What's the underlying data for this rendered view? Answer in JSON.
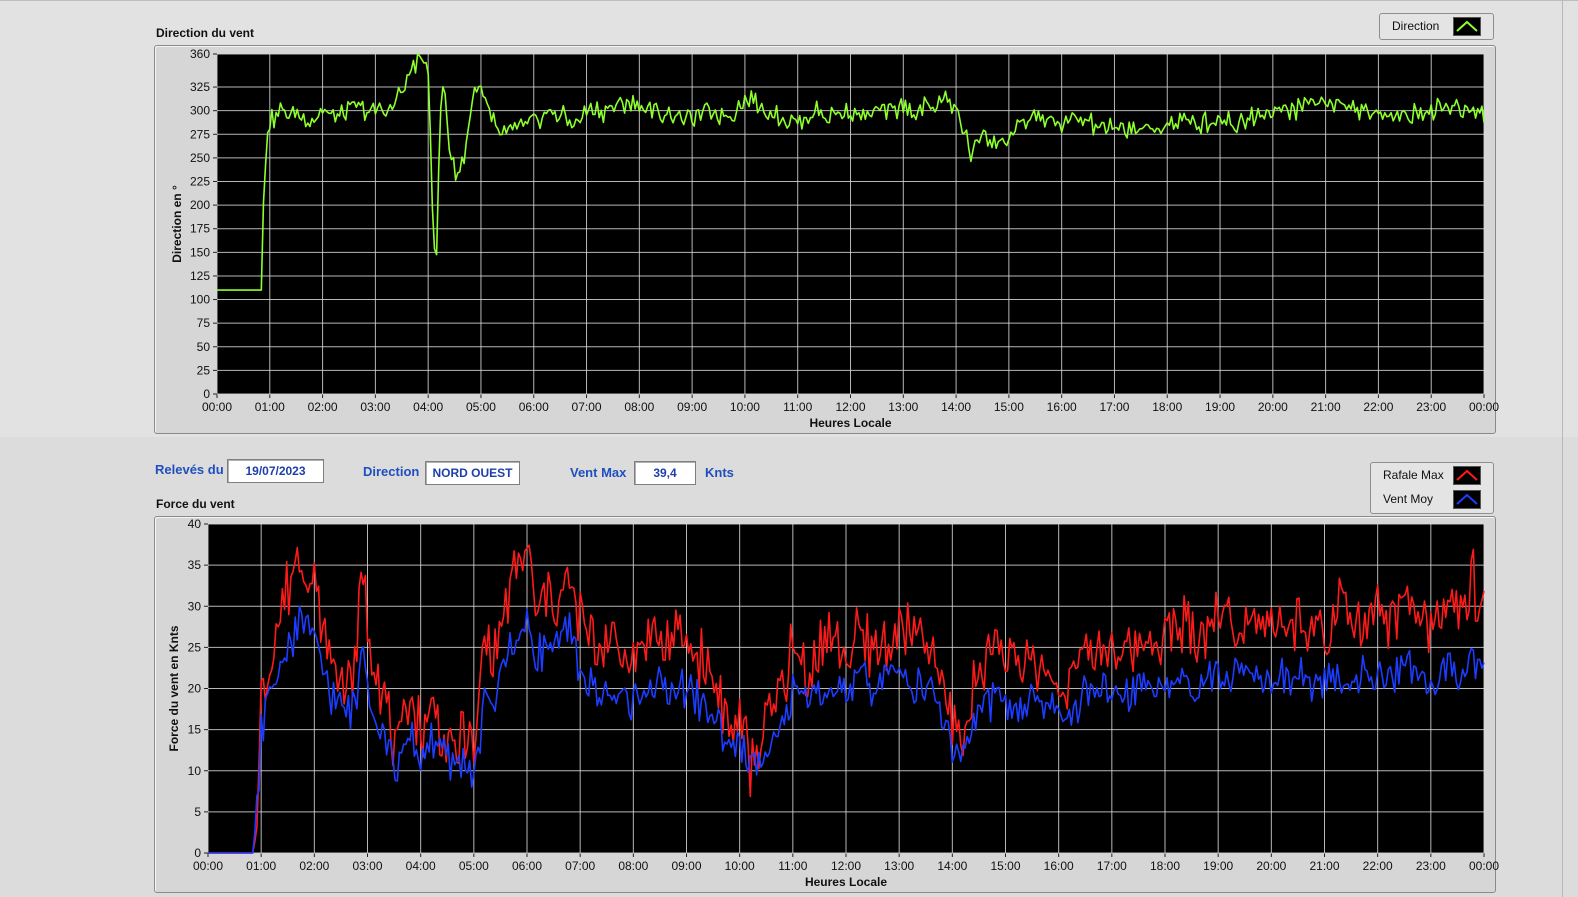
{
  "colors": {
    "direction": "#8cff2c",
    "gust": "#ff1a1a",
    "mean": "#1c3cff",
    "plot_bg": "#000000",
    "grid": "#d8d8d8"
  },
  "direction_panel": {
    "title": "Direction du vent",
    "legend_label": "Direction",
    "xlabel": "Heures Locale",
    "ylabel": "Direction en °"
  },
  "controls": {
    "releves_label": "Relevés du",
    "date_value": "19/07/2023",
    "direction_label": "Direction",
    "direction_value": "NORD OUEST",
    "ventmax_label": "Vent Max",
    "ventmax_value": "39,4",
    "unit": "Knts"
  },
  "force_panel": {
    "title": "Force du vent",
    "legend": [
      "Rafale Max",
      "Vent Moy"
    ],
    "xlabel": "Heures Locale",
    "ylabel": "Force du vent en Knts"
  },
  "chart_data": [
    {
      "type": "line",
      "title": "Direction du vent",
      "xlabel": "Heures Locale",
      "ylabel": "Direction en °",
      "x_ticks": [
        "00:00",
        "01:00",
        "02:00",
        "03:00",
        "04:00",
        "05:00",
        "06:00",
        "07:00",
        "08:00",
        "09:00",
        "10:00",
        "11:00",
        "12:00",
        "13:00",
        "14:00",
        "15:00",
        "16:00",
        "17:00",
        "18:00",
        "19:00",
        "20:00",
        "21:00",
        "22:00",
        "23:00",
        "00:00"
      ],
      "xlim_hours": [
        0,
        24
      ],
      "ylim": [
        0,
        360
      ],
      "y_ticks": [
        0,
        25,
        50,
        75,
        100,
        125,
        150,
        175,
        200,
        225,
        250,
        275,
        300,
        325,
        360
      ],
      "grid": true,
      "legend_position": "top-right",
      "series": [
        {
          "name": "Direction",
          "x": [
            0,
            0.5,
            0.85,
            0.88,
            0.95,
            1.0,
            1.2,
            1.5,
            1.8,
            2.0,
            2.3,
            2.6,
            3.0,
            3.3,
            3.5,
            3.75,
            3.9,
            4.0,
            4.05,
            4.1,
            4.15,
            4.2,
            4.25,
            4.3,
            4.4,
            4.5,
            4.6,
            4.7,
            4.8,
            4.9,
            5.0,
            5.1,
            5.2,
            5.3,
            5.5,
            5.8,
            6.0,
            6.3,
            6.5,
            6.8,
            7.0,
            7.3,
            7.5,
            7.7,
            8.0,
            8.3,
            8.5,
            8.8,
            9.0,
            9.3,
            9.5,
            9.8,
            10.0,
            10.3,
            10.6,
            11.0,
            11.3,
            11.6,
            12.0,
            12.3,
            12.6,
            13.0,
            13.3,
            13.6,
            13.8,
            14.0,
            14.1,
            14.2,
            14.3,
            14.5,
            14.7,
            15.0,
            15.3,
            15.5,
            15.8,
            16.0,
            16.3,
            16.6,
            17.0,
            17.3,
            17.6,
            18.0,
            18.3,
            18.6,
            19.0,
            19.3,
            19.6,
            20.0,
            20.3,
            20.6,
            21.0,
            21.3,
            21.6,
            22.0,
            22.3,
            22.6,
            23.0,
            23.3,
            23.6,
            24.0
          ],
          "values": [
            110,
            110,
            110,
            200,
            280,
            290,
            300,
            295,
            290,
            300,
            290,
            305,
            300,
            300,
            320,
            350,
            355,
            345,
            260,
            160,
            128,
            230,
            320,
            330,
            260,
            240,
            235,
            260,
            300,
            325,
            320,
            305,
            290,
            280,
            275,
            285,
            285,
            300,
            295,
            285,
            300,
            300,
            305,
            310,
            305,
            300,
            295,
            295,
            290,
            300,
            295,
            300,
            315,
            305,
            295,
            285,
            300,
            295,
            300,
            295,
            300,
            305,
            300,
            305,
            315,
            300,
            290,
            270,
            250,
            280,
            265,
            270,
            290,
            295,
            290,
            285,
            290,
            285,
            280,
            280,
            280,
            285,
            290,
            285,
            295,
            285,
            295,
            300,
            300,
            305,
            310,
            305,
            300,
            295,
            300,
            295,
            300,
            305,
            300,
            300
          ]
        }
      ]
    },
    {
      "type": "line",
      "title": "Force du vent",
      "xlabel": "Heures Locale",
      "ylabel": "Force du vent en Knts",
      "x_ticks": [
        "00:00",
        "01:00",
        "02:00",
        "03:00",
        "04:00",
        "05:00",
        "06:00",
        "07:00",
        "08:00",
        "09:00",
        "10:00",
        "11:00",
        "12:00",
        "13:00",
        "14:00",
        "15:00",
        "16:00",
        "17:00",
        "18:00",
        "19:00",
        "20:00",
        "21:00",
        "22:00",
        "23:00",
        "00:00"
      ],
      "xlim_hours": [
        0,
        24
      ],
      "ylim": [
        0,
        40
      ],
      "y_ticks": [
        0,
        5,
        10,
        15,
        20,
        25,
        30,
        35,
        40
      ],
      "grid": true,
      "legend_position": "top-right",
      "series": [
        {
          "name": "Rafale Max",
          "x": [
            0,
            0.5,
            0.85,
            0.95,
            1.0,
            1.2,
            1.4,
            1.6,
            1.8,
            2.0,
            2.2,
            2.4,
            2.6,
            2.8,
            2.9,
            3.0,
            3.2,
            3.4,
            3.6,
            3.8,
            4.0,
            4.2,
            4.4,
            4.6,
            4.8,
            5.0,
            5.2,
            5.4,
            5.6,
            5.8,
            6.0,
            6.2,
            6.4,
            6.6,
            6.8,
            7.0,
            7.3,
            7.6,
            8.0,
            8.3,
            8.6,
            9.0,
            9.3,
            9.6,
            9.8,
            10.0,
            10.2,
            10.5,
            10.8,
            11.0,
            11.3,
            11.6,
            12.0,
            12.3,
            12.6,
            13.0,
            13.3,
            13.6,
            13.8,
            14.0,
            14.2,
            14.5,
            14.8,
            15.0,
            15.2,
            15.5,
            15.8,
            16.0,
            16.3,
            16.6,
            17.0,
            17.3,
            17.6,
            18.0,
            18.3,
            18.6,
            19.0,
            19.3,
            19.6,
            20.0,
            20.3,
            20.6,
            21.0,
            21.3,
            21.6,
            22.0,
            22.3,
            22.6,
            23.0,
            23.3,
            23.6,
            23.8,
            24.0
          ],
          "values": [
            0,
            0,
            0,
            8,
            20,
            24,
            30,
            34,
            36,
            32,
            26,
            22,
            21,
            23,
            37,
            28,
            22,
            16,
            12,
            20,
            14,
            18,
            15,
            12,
            15,
            11,
            26,
            24,
            30,
            34,
            37,
            28,
            32,
            30,
            33,
            28,
            25,
            26,
            24,
            27,
            25,
            26,
            24,
            20,
            15,
            16,
            11,
            15,
            20,
            25,
            22,
            26,
            24,
            26,
            25,
            27,
            26,
            24,
            21,
            16,
            14,
            22,
            26,
            24,
            22,
            24,
            21,
            20,
            22,
            24,
            26,
            24,
            27,
            26,
            28,
            27,
            29,
            27,
            30,
            28,
            27,
            28,
            26,
            30,
            27,
            29,
            28,
            30,
            27,
            31,
            29,
            33,
            30
          ]
        },
        {
          "name": "Vent Moy",
          "x": [
            0,
            0.5,
            0.85,
            0.95,
            1.0,
            1.2,
            1.4,
            1.6,
            1.8,
            2.0,
            2.2,
            2.4,
            2.6,
            2.8,
            2.9,
            3.0,
            3.2,
            3.4,
            3.6,
            3.8,
            4.0,
            4.2,
            4.4,
            4.6,
            4.8,
            5.0,
            5.2,
            5.4,
            5.6,
            5.8,
            6.0,
            6.2,
            6.4,
            6.6,
            6.8,
            7.0,
            7.3,
            7.6,
            8.0,
            8.3,
            8.6,
            9.0,
            9.3,
            9.6,
            9.8,
            10.0,
            10.2,
            10.5,
            10.8,
            11.0,
            11.3,
            11.6,
            12.0,
            12.3,
            12.6,
            13.0,
            13.3,
            13.6,
            13.8,
            14.0,
            14.2,
            14.5,
            14.8,
            15.0,
            15.2,
            15.5,
            15.8,
            16.0,
            16.3,
            16.6,
            17.0,
            17.3,
            17.6,
            18.0,
            18.3,
            18.6,
            19.0,
            19.3,
            19.6,
            20.0,
            20.3,
            20.6,
            21.0,
            21.3,
            21.6,
            22.0,
            22.3,
            22.6,
            23.0,
            23.3,
            23.6,
            23.8,
            24.0
          ],
          "values": [
            0,
            0,
            0,
            6,
            15,
            20,
            24,
            26,
            29,
            25,
            22,
            18,
            17,
            19,
            27,
            21,
            15,
            13,
            10,
            14,
            11,
            14,
            12,
            10,
            12,
            9,
            18,
            19,
            24,
            26,
            28,
            24,
            26,
            25,
            27,
            22,
            19,
            19,
            18,
            21,
            19,
            20,
            18,
            16,
            13,
            13,
            10,
            13,
            16,
            19,
            18,
            20,
            19,
            21,
            20,
            22,
            21,
            19,
            17,
            13,
            12,
            17,
            19,
            18,
            17,
            19,
            17,
            17,
            18,
            19,
            20,
            19,
            21,
            20,
            21,
            20,
            22,
            21,
            23,
            21,
            21,
            22,
            20,
            22,
            21,
            22,
            21,
            23,
            20,
            23,
            22,
            24,
            23
          ]
        }
      ]
    }
  ]
}
